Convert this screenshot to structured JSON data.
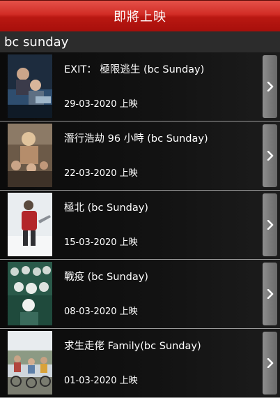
{
  "header": {
    "title": "即將上映"
  },
  "section": {
    "title": "bc sunday"
  },
  "movies": [
    {
      "title": "EXIT： 極限逃生 (bc Sunday)",
      "date": "29-03-2020 上映"
    },
    {
      "title": "潛行浩劫 96 小時 (bc Sunday)",
      "date": "22-03-2020 上映"
    },
    {
      "title": "極北 (bc Sunday)",
      "date": "15-03-2020 上映"
    },
    {
      "title": "戰疫 (bc Sunday)",
      "date": "08-03-2020 上映"
    },
    {
      "title": "求生走佬 Family(bc Sunday)",
      "date": "01-03-2020 上映"
    }
  ],
  "icons": {
    "row_action": "chevron-right-icon"
  },
  "colors": {
    "header_red": "#c8221c",
    "section_bar": "#2c2c2c",
    "button_gray": "#7a7a7a"
  }
}
